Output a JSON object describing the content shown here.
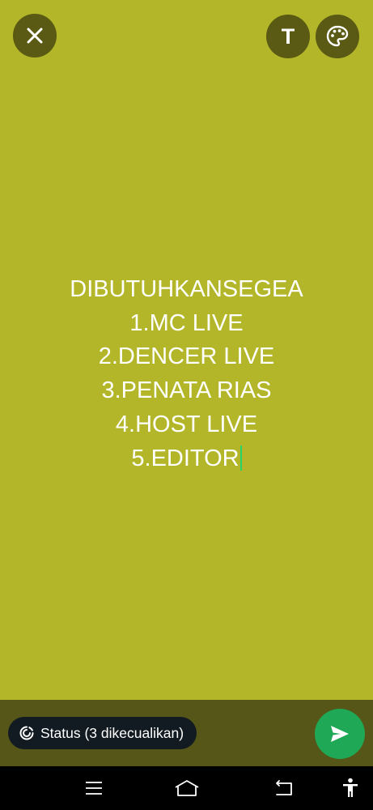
{
  "status_composer": {
    "background_color": "#b4b629",
    "text_color": "#ffffff",
    "cursor_color": "#25d366",
    "lines": [
      "DIBUTUHKANSEGEA",
      "1.MC LIVE",
      "2.DENCER LIVE",
      "3.PENATA RIAS",
      "4.HOST LIVE",
      "5.EDITOR"
    ]
  },
  "top_bar": {
    "close_icon": "close-icon",
    "text_style_label": "T",
    "palette_icon": "palette-icon"
  },
  "footer": {
    "audience_label": "Status (3 dikecualikan)",
    "audience_icon": "status-ring-icon",
    "send_icon": "send-icon",
    "send_color": "#1fa855"
  },
  "system_nav": {
    "items": [
      "recents-icon",
      "home-icon",
      "back-icon",
      "accessibility-icon"
    ]
  }
}
